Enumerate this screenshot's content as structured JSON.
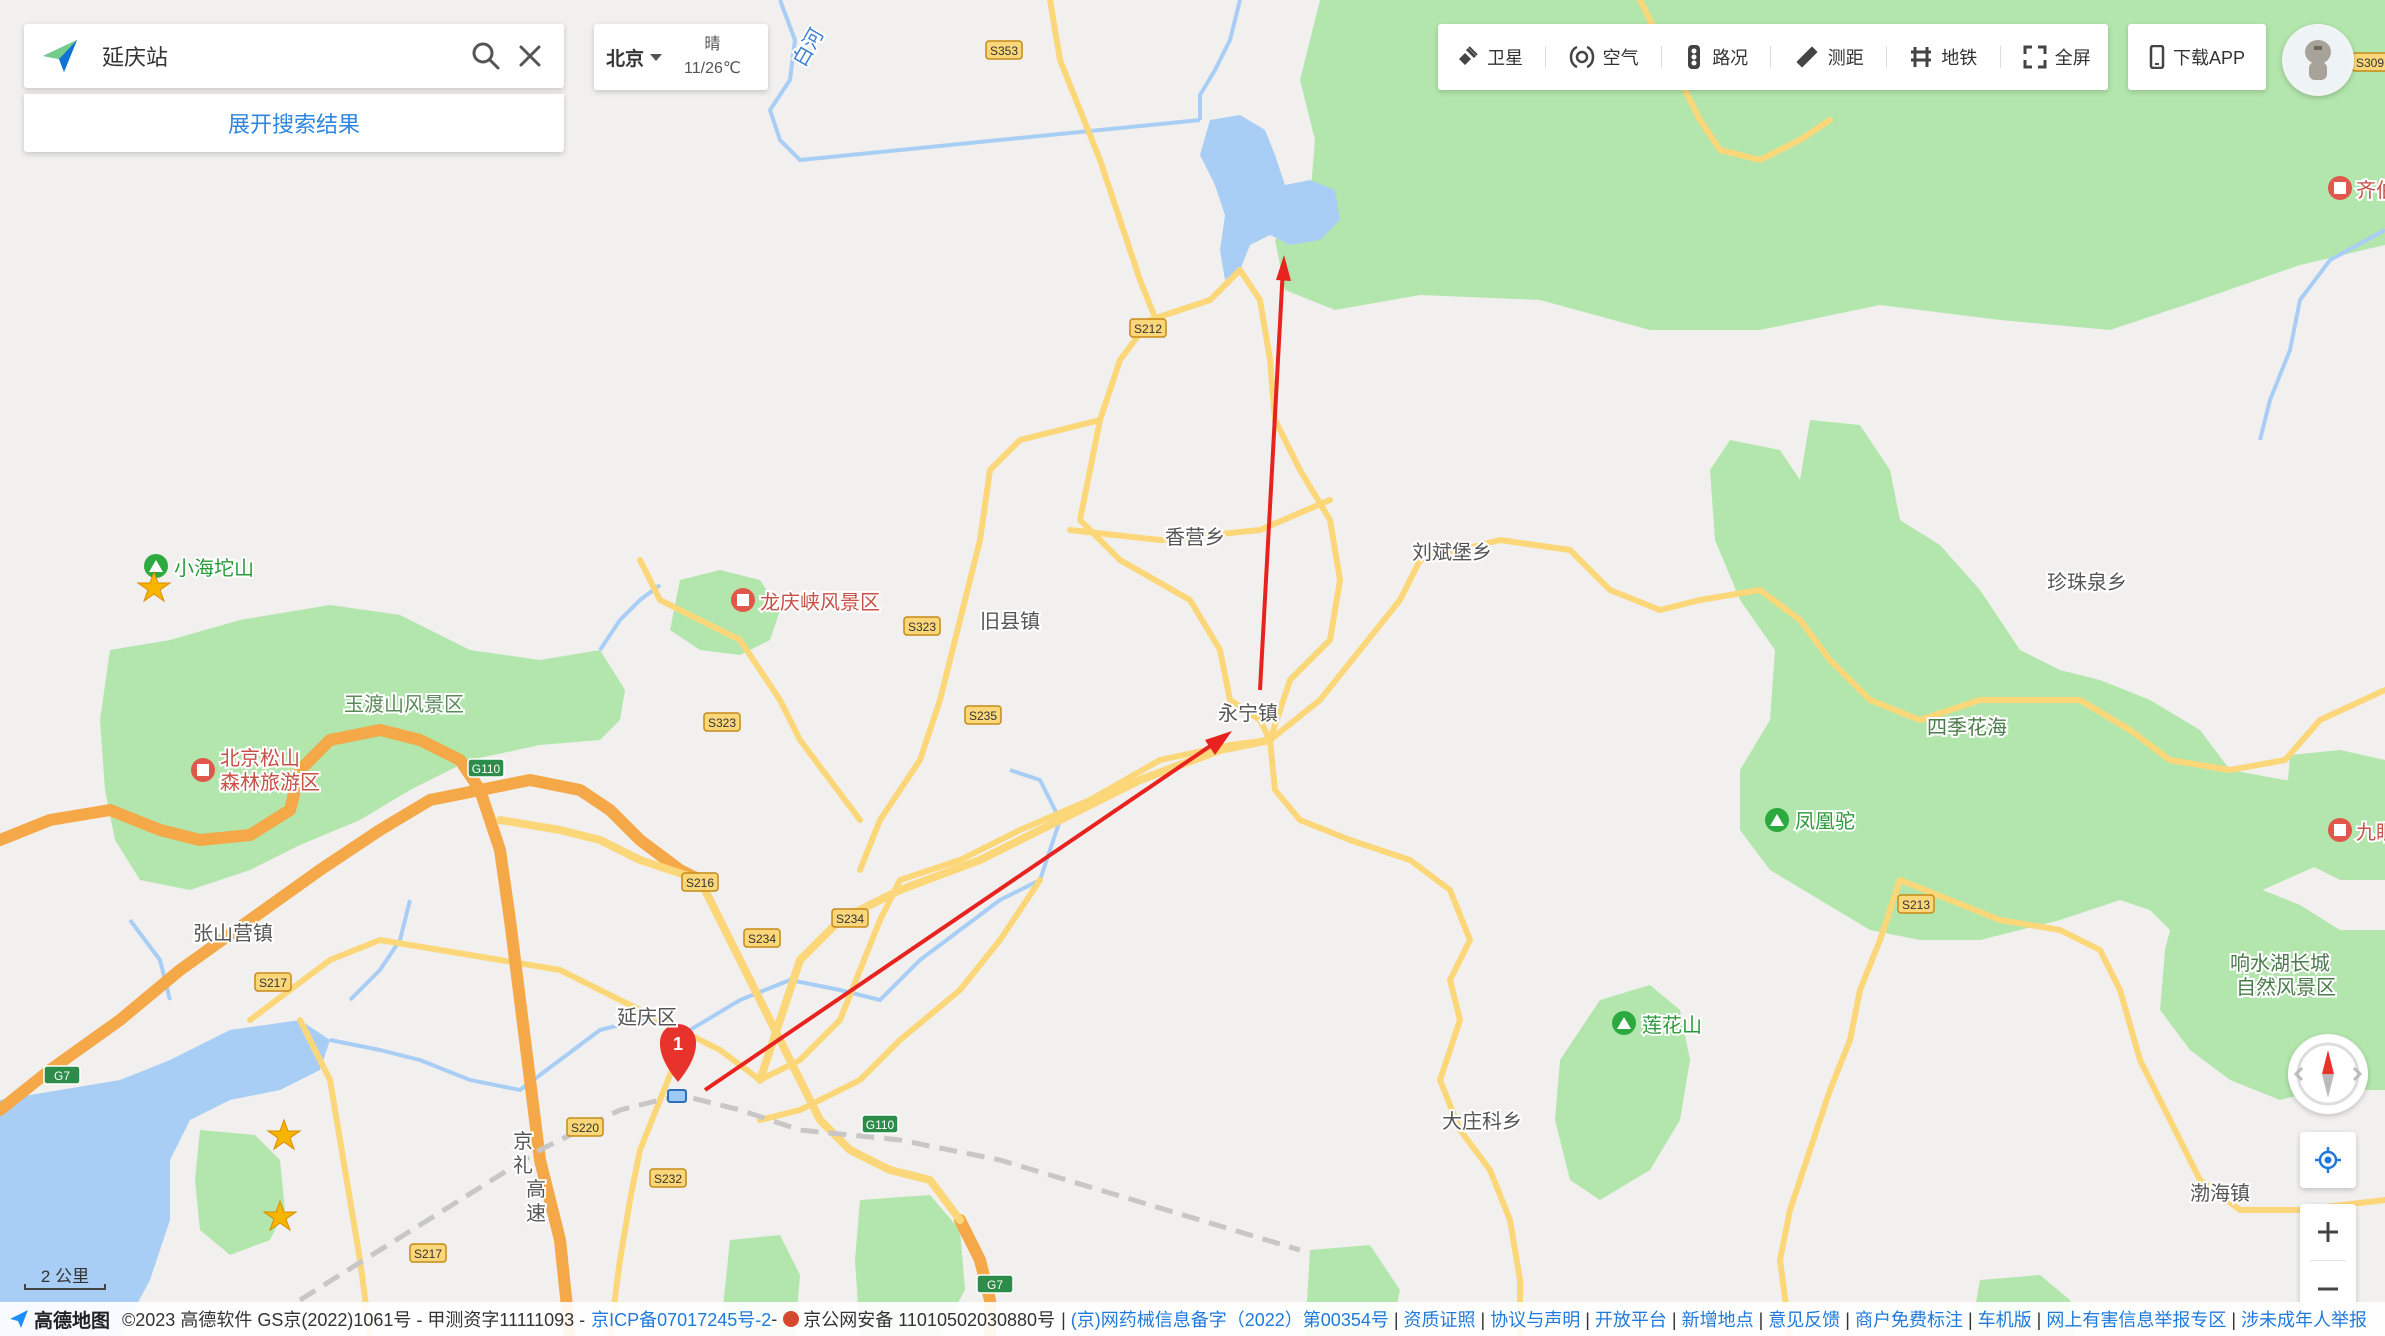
{
  "search": {
    "query": "延庆站",
    "expand_label": "展开搜索结果"
  },
  "weather": {
    "city": "北京",
    "condition": "晴",
    "temperature": "11/26℃"
  },
  "toolbar": {
    "items": [
      {
        "label": "卫星",
        "icon": "satellite-icon"
      },
      {
        "label": "空气",
        "icon": "air-icon"
      },
      {
        "label": "路况",
        "icon": "traffic-icon"
      },
      {
        "label": "测距",
        "icon": "ruler-icon"
      },
      {
        "label": "地铁",
        "icon": "subway-icon"
      },
      {
        "label": "全屏",
        "icon": "fullscreen-icon"
      }
    ],
    "download_label": "下载APP"
  },
  "map": {
    "scale_label": "2 公里",
    "marker_number": "1",
    "places": {
      "xiaohaituo": "小海坨山",
      "longqingxia": "龙庆峡风景区",
      "yuduhshan": "玉渡山风景区",
      "songshan_1": "北京松山",
      "songshan_2": "森林旅游区",
      "zhangshanying": "张山营镇",
      "xiangying": "香营乡",
      "jiuxian": "旧县镇",
      "liubinpu": "刘斌堡乡",
      "yongning": "永宁镇",
      "zhenzhuquan": "珍珠泉乡",
      "sijihuahai": "四季花海",
      "fenghuangtuo": "凤凰驼",
      "yanqingqu": "延庆区",
      "lianhuashan": "莲花山",
      "dazhuangke": "大庄科乡",
      "xiangshuihu_1": "响水湖长城",
      "xiangshuihu_2": "自然风景区",
      "bohai": "渤海镇",
      "qi_edge": "齐伯",
      "jiu_edge": "九眼",
      "baihe": "白河",
      "jingli_1": "京",
      "jingli_2": "礼",
      "jingli_3": "高",
      "jingli_4": "速"
    },
    "roads": [
      "S353",
      "S212",
      "S323",
      "S323",
      "S235",
      "G110",
      "S216",
      "S234",
      "S234",
      "S217",
      "G7",
      "S220",
      "S232",
      "G110",
      "S217",
      "G7",
      "S212",
      "S213",
      "S309"
    ]
  },
  "footer": {
    "brand": "高德地图",
    "copyright": "©2023 高德软件 GS京(2022)1061号 - 甲测资字11111093 -",
    "icp": "京ICP备07017245号-2",
    "sep1": "-",
    "police": "京公网安备 11010502030880号",
    "links": [
      "(京)网药械信息备字（2022）第00354号",
      "资质证照",
      "协议与声明",
      "开放平台",
      "新增地点",
      "意见反馈",
      "商户免费标注",
      "车机版",
      "网上有害信息举报专区",
      "涉未成年人举报"
    ]
  },
  "colors": {
    "land": "#f1f0ee",
    "park": "#b3e6ad",
    "water": "#a9cef5",
    "road_major": "#f5a847",
    "road_minor": "#fcd77a",
    "arrow": "#e8231f",
    "link": "#1f7adb"
  }
}
